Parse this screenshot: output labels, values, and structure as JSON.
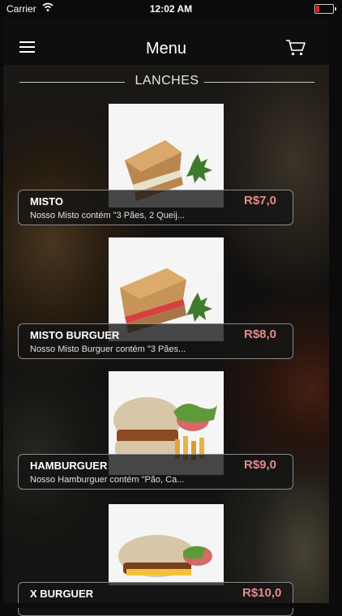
{
  "status_bar": {
    "carrier": "Carrier",
    "time": "12:02 AM"
  },
  "header": {
    "title": "Menu"
  },
  "section": {
    "title": "LANCHES"
  },
  "colors": {
    "accent_price": "#e28a8a",
    "battery_low": "#e02b2b"
  },
  "products": [
    {
      "name": "MISTO",
      "price": "R$7,0",
      "description": "Nosso Misto contém \"3 Pães, 2 Queij..."
    },
    {
      "name": "MISTO BURGUER",
      "price": "R$8,0",
      "description": "Nosso Misto Burguer contém \"3 Pães..."
    },
    {
      "name": "HAMBURGUER",
      "price": "R$9,0",
      "description": "Nosso Hamburguer contém \"Pão, Ca..."
    },
    {
      "name": "X BURGUER",
      "price": "R$10,0",
      "description": ""
    }
  ]
}
